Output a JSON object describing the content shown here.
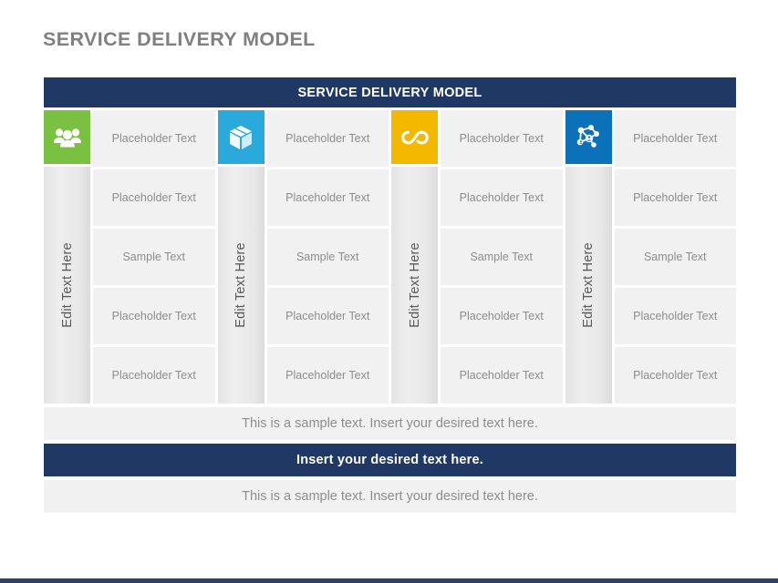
{
  "slide": {
    "title": "SERVICE DELIVERY MODEL",
    "header_band": "SERVICE DELIVERY MODEL"
  },
  "colors": {
    "navy": "#1f3864",
    "title_gray": "#808080",
    "cell_gray": "#f1f1f1",
    "text_gray": "#8d8d8d",
    "accent_bar": "#2e4365"
  },
  "groups": [
    {
      "icon": "people-group-icon",
      "icon_color": "#7ac142",
      "vertical_label": "Edit Text Here",
      "cells": [
        "Placeholder Text",
        "Placeholder Text",
        "Sample Text",
        "Placeholder Text",
        "Placeholder Text"
      ]
    },
    {
      "icon": "package-box-icon",
      "icon_color": "#29a9dc",
      "vertical_label": "Edit Text Here",
      "cells": [
        "Placeholder Text",
        "Placeholder Text",
        "Sample Text",
        "Placeholder Text",
        "Placeholder Text"
      ]
    },
    {
      "icon": "infinity-loop-icon",
      "icon_color": "#f5b800",
      "vertical_label": "Edit Text Here",
      "cells": [
        "Placeholder Text",
        "Placeholder Text",
        "Sample Text",
        "Placeholder Text",
        "Placeholder Text"
      ]
    },
    {
      "icon": "network-nodes-icon",
      "icon_color": "#0b72b9",
      "vertical_label": "Edit Text Here",
      "cells": [
        "Placeholder Text",
        "Placeholder Text",
        "Sample Text",
        "Placeholder Text",
        "Placeholder Text"
      ]
    }
  ],
  "footer_bars": [
    {
      "style": "light",
      "text": "This is a sample text. Insert your desired text here."
    },
    {
      "style": "navy",
      "text": "Insert your desired text here."
    },
    {
      "style": "light",
      "text": "This is a sample text. Insert your desired text here."
    }
  ]
}
